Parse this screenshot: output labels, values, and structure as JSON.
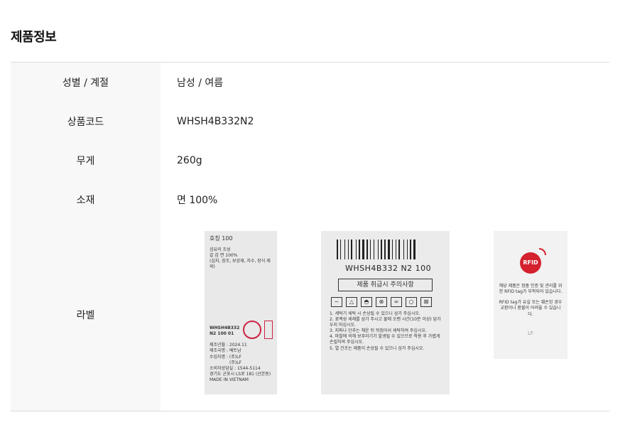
{
  "section_title": "제품정보",
  "rows": [
    {
      "label": "성별 / 계절",
      "value": "남성 / 여름"
    },
    {
      "label": "상품코드",
      "value": "WHSH4B332N2"
    },
    {
      "label": "무게",
      "value": "260g"
    },
    {
      "label": "소재",
      "value": "면 100%"
    },
    {
      "label": "라벨"
    }
  ],
  "label_image_1": {
    "size_line": "호칭      100",
    "fiber_title": "섬유의 조성",
    "fiber_line": "겉 감      면      100%",
    "fiber_note": "(심지, 장조, 보강재, 자수, 장식 제외)",
    "code_line1": "WHSH4B332",
    "code_line2": "N2  100  01",
    "made_date": "제조년월 : 2024.11",
    "country": "제조국명 : 베트남",
    "importer": "수입자명 : (주)LF",
    "importer2": "(주)LF",
    "cs_line": "소비자상담실 : 1544-5114",
    "addr": "경기도 군포시 LS로 181 (산본동)",
    "made_in": "MADE IN VIETNAM"
  },
  "label_image_2": {
    "code": "WHSH4B332  N2 100",
    "care_title": "제품 취급시 주의사항",
    "care_items": [
      "1. 세탁기 세탁 시 손상될 수 있으니 삼가 주십시오.",
      "2. 표백성 세제를 삼가 주시고 물에 오랜 시간(10분 이상) 담가 두지 마십시오.",
      "3. 지퍼나 단추는 채운 뒤 뒤집어서 세탁하여 주십시오.",
      "4. 마찰에 의해 보푸라기가 발생될 수 있으므로 착용 후 가볍게 손질하여 주십시오.",
      "5. 열 건조는 제품이 손상될 수 있으니 삼가 주십시오."
    ]
  },
  "label_image_3": {
    "badge": "RFID",
    "text1": "해당 제품은 정품 인증 및 관리를 위한 RFID tag가 부착되어 있습니다.",
    "text2": "RFID tag가 유실 또는 훼손된 경우 교환이나 환불이 어려울 수 있습니다.",
    "logo": "LF"
  }
}
